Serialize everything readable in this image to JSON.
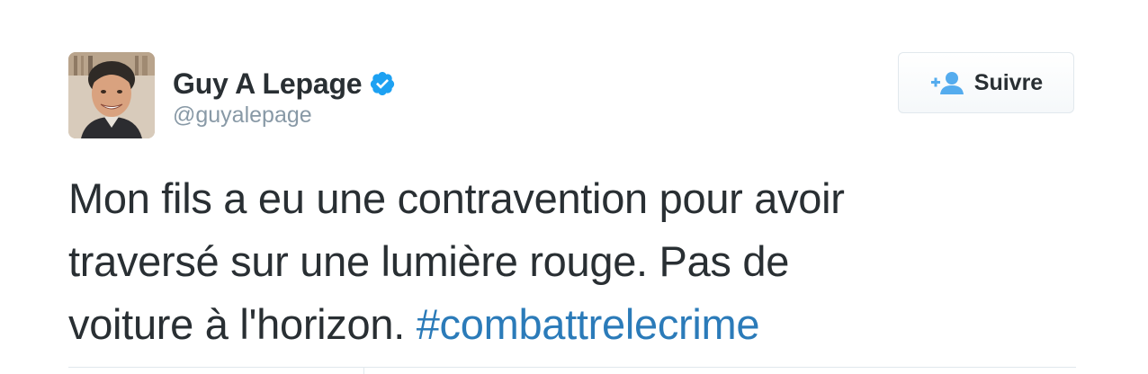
{
  "author": {
    "display_name": "Guy A Lepage",
    "handle": "@guyalepage",
    "verified": true,
    "avatar_icon": "profile-photo"
  },
  "follow_button": {
    "label": "Suivre",
    "icon": "follow-user-plus-icon"
  },
  "tweet": {
    "text_line_1": "Mon fils a eu une contravention pour avoir",
    "text_line_2": "traversé sur une lumière rouge. Pas de",
    "text_line_3_prefix": "voiture à l'horizon.",
    "hashtag": "#combattrelecrime"
  },
  "colors": {
    "text": "#292f33",
    "secondary": "#8899a6",
    "link": "#2b7bb9",
    "verified": "#1da1f2",
    "follow_icon": "#55acee"
  }
}
